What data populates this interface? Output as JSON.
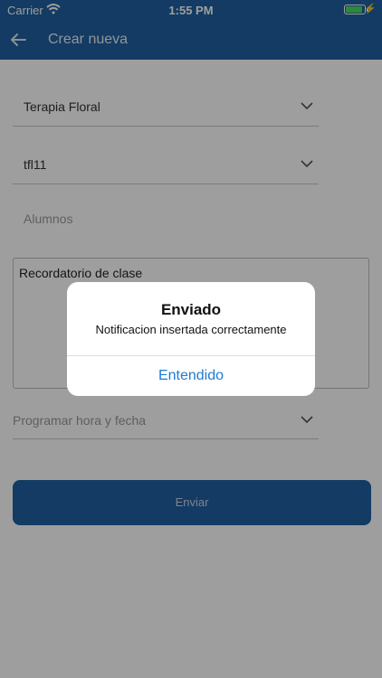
{
  "status_bar": {
    "carrier": "Carrier",
    "time": "1:55 PM",
    "battery_level": 0.95,
    "wifi_icon": "wifi-icon",
    "charging_icon": "bolt-icon"
  },
  "nav": {
    "title": "Crear nueva",
    "back_icon": "arrow-left-icon"
  },
  "form": {
    "course": "Terapia Floral",
    "group": "tfl11",
    "students_placeholder": "Alumnos",
    "message": "Recordatorio de clase",
    "schedule_placeholder": "Programar hora y fecha",
    "send_label": "Enviar"
  },
  "alert": {
    "title": "Enviado",
    "message": "Notificacion insertada correctamente",
    "button": "Entendido"
  },
  "colors": {
    "brand": "#1f5fa0",
    "link": "#1f7ad0"
  }
}
